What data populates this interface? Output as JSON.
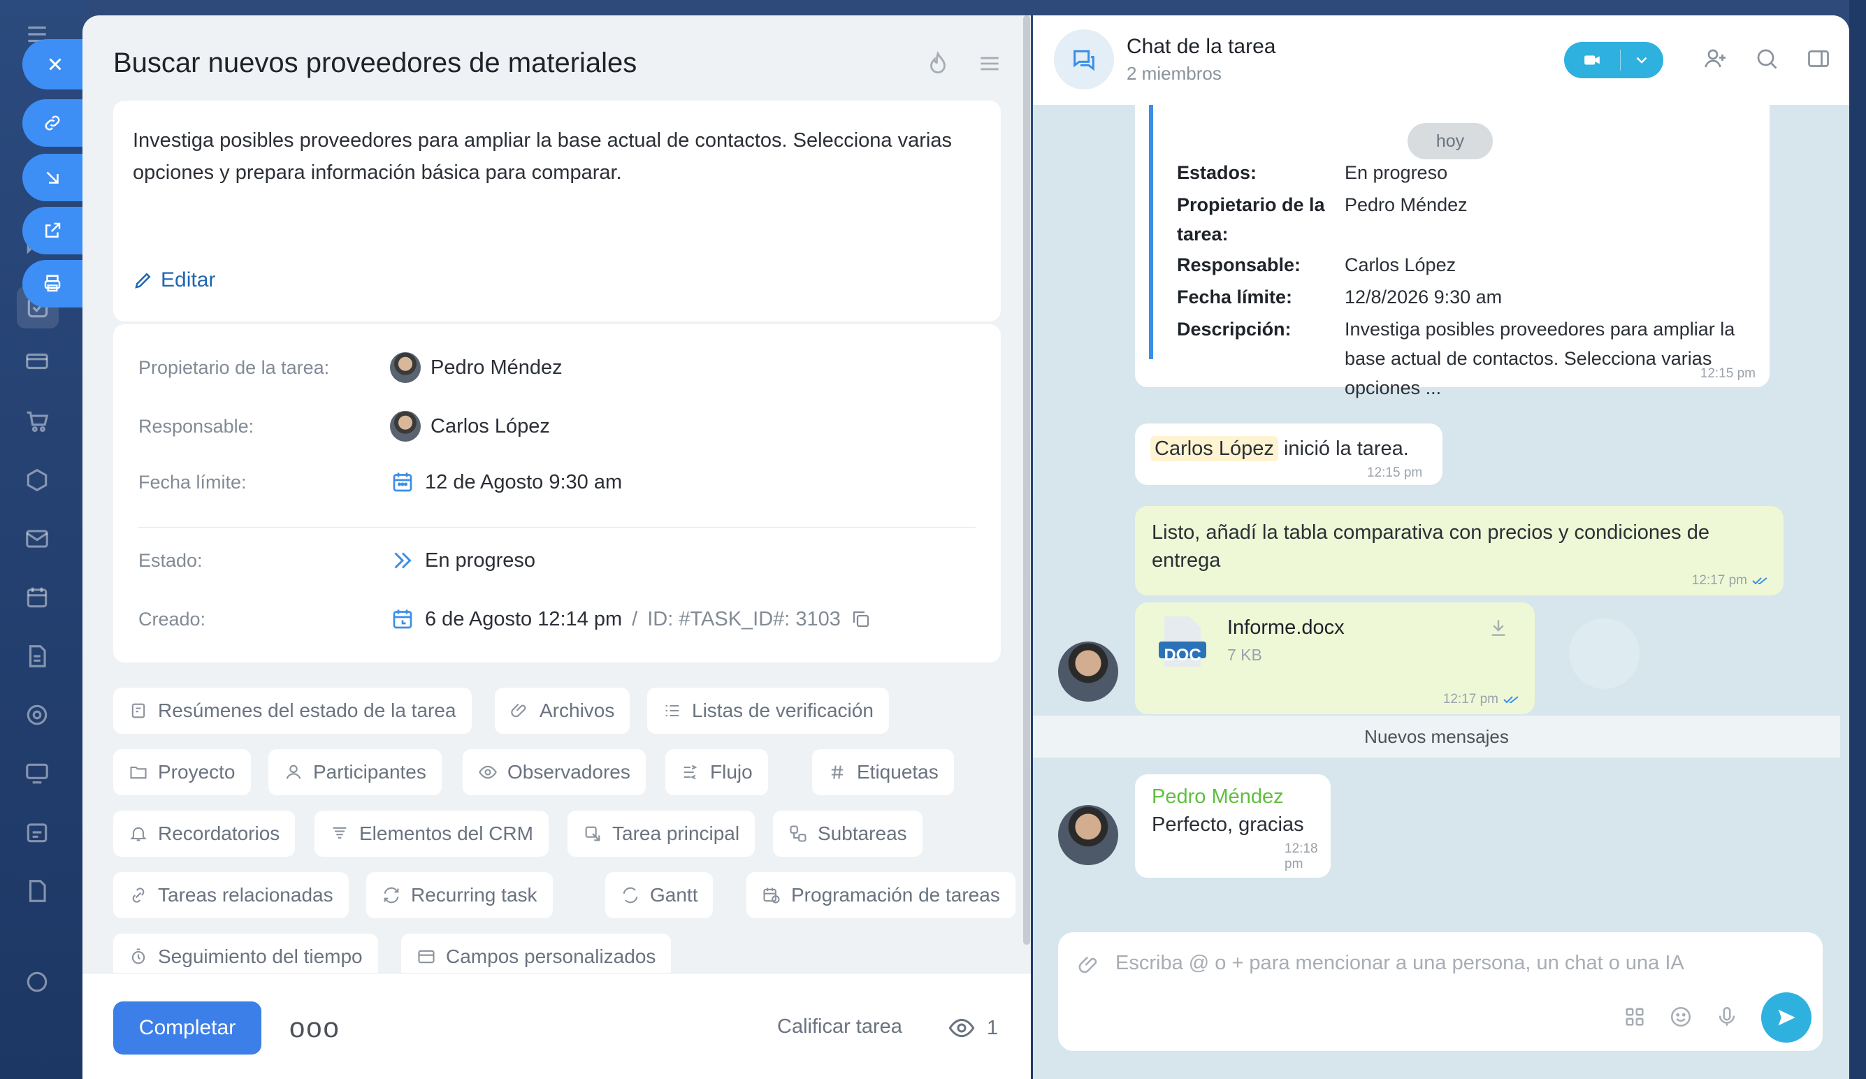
{
  "task": {
    "title": "Buscar nuevos proveedores de materiales",
    "description": "Investiga posibles proveedores para ampliar la base actual de contactos. Selecciona varias opciones y prepara información básica para comparar.",
    "edit_label": "Editar",
    "fields": {
      "owner_label": "Propietario de la tarea:",
      "owner_value": "Pedro Méndez",
      "responsible_label": "Responsable:",
      "responsible_value": "Carlos López",
      "deadline_label": "Fecha límite:",
      "deadline_value": "12 de Agosto 9:30 am",
      "status_label": "Estado:",
      "status_value": "En progreso",
      "created_label": "Creado:",
      "created_value": "6 de Agosto 12:14 pm",
      "created_sep": "/",
      "task_id": "ID: #TASK_ID#: 3103"
    },
    "chips": [
      "Resúmenes del estado de la tarea",
      "Archivos",
      "Listas de verificación",
      "Proyecto",
      "Participantes",
      "Observadores",
      "Flujo",
      "Etiquetas",
      "Recordatorios",
      "Elementos del CRM",
      "Tarea principal",
      "Subtareas",
      "Tareas relacionadas",
      "Recurring task",
      "Gantt",
      "Programación de tareas",
      "Seguimiento del tiempo",
      "Campos personalizados"
    ],
    "footer": {
      "complete_label": "Completar",
      "more_label": "ooo",
      "rate_label": "Calificar tarea",
      "views_count": "1"
    }
  },
  "chat": {
    "title": "Chat de la tarea",
    "members": "2 miembros",
    "date_chip": "hoy",
    "system_card": {
      "rows": [
        {
          "key": "Estados:",
          "value": "En progreso"
        },
        {
          "key": "Propietario de la tarea:",
          "value": "Pedro Méndez"
        },
        {
          "key": "Responsable:",
          "value": "Carlos López"
        },
        {
          "key": "Fecha límite:",
          "value": "12/8/2026 9:30 am"
        },
        {
          "key": "Descripción:",
          "value": "Investiga posibles proveedores para ampliar la base actual de contactos. Selecciona varias opciones ..."
        }
      ],
      "time": "12:15 pm"
    },
    "started": {
      "name": "Carlos López",
      "text": "inició la tarea.",
      "time": "12:15 pm"
    },
    "msg1": {
      "text": "Listo, añadí la tabla comparativa con precios y condiciones de entrega",
      "time": "12:17 pm"
    },
    "file": {
      "badge": "DOC",
      "name": "Informe.docx",
      "size": "7 KB",
      "time": "12:17 pm"
    },
    "new_messages": "Nuevos mensajes",
    "msg2": {
      "author": "Pedro Méndez",
      "text": "Perfecto, gracias",
      "time": "12:18 pm"
    },
    "composer_placeholder": "Escriba @ o + para mencionar a una persona, un chat o una IA"
  },
  "colors": {
    "accent": "#3d7fe8",
    "chat_accent": "#2fb1e0",
    "author_green": "#5fbf3d"
  }
}
